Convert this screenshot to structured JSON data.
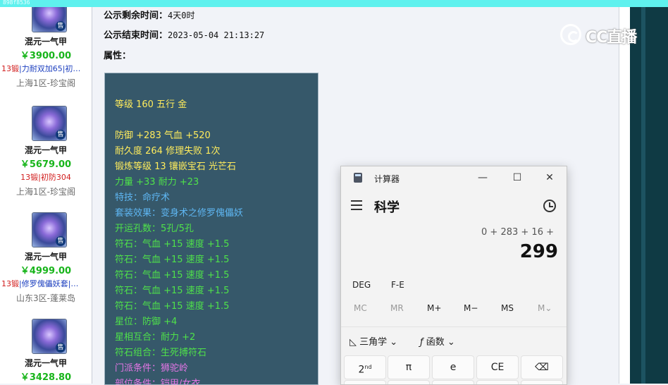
{
  "topbar": {
    "label": "898f8536"
  },
  "listings": [
    {
      "name": "混元一气甲",
      "price": "￥3900.00",
      "attr_red": "13锻",
      "attr_rest": "|力耐双加65|初…",
      "server": "上海1区-珍宝阁",
      "sell_badge": "售"
    },
    {
      "name": "混元一气甲",
      "price": "￥5679.00",
      "attr_red": "13锻|初防304",
      "attr_rest": "",
      "server": "上海1区-珍宝阁",
      "sell_badge": "售"
    },
    {
      "name": "混元一气甲",
      "price": "￥4999.00",
      "attr_red": "13锻",
      "attr_rest": "|修罗傀儡妖套|…",
      "server": "山东3区-蓬莱岛",
      "sell_badge": "售"
    },
    {
      "name": "混元一气甲",
      "price": "￥3428.80",
      "attr_red": "",
      "attr_rest": "",
      "server": "",
      "sell_badge": "售"
    }
  ],
  "detail": {
    "remaining_label": "公示剩余时间：",
    "remaining_value": "4天0时",
    "end_label": "公示结束时间：",
    "end_value": "2023-05-04 21:13:27",
    "attr_label": "属性："
  },
  "attributes": [
    {
      "text": "等级 160 五行 金",
      "color": "yellow"
    },
    {
      "text": "防御 +283 气血 +520",
      "color": "yellow"
    },
    {
      "text": "耐久度 264 修理失败 1次",
      "color": "yellow"
    },
    {
      "text": "锻炼等级 13 镶嵌宝石 光芒石",
      "color": "yellow"
    },
    {
      "text": "力量 +33 耐力 +23",
      "color": "green"
    },
    {
      "text": "特技：命疗术",
      "color": "blue"
    },
    {
      "text": "套装效果：变身术之修罗傀儡妖",
      "color": "blue"
    },
    {
      "text": "开运孔数：5孔/5孔",
      "color": "green"
    },
    {
      "text": "符石：气血 +15 速度 +1.5",
      "color": "green"
    },
    {
      "text": "符石：气血 +15 速度 +1.5",
      "color": "green"
    },
    {
      "text": "符石：气血 +15 速度 +1.5",
      "color": "green"
    },
    {
      "text": "符石：气血 +15 速度 +1.5",
      "color": "green"
    },
    {
      "text": "符石：气血 +15 速度 +1.5",
      "color": "green"
    },
    {
      "text": "星位：防御 +4",
      "color": "green"
    },
    {
      "text": "星相互合：耐力 +2",
      "color": "green"
    },
    {
      "text": "符石组合：生死搏符石",
      "color": "green"
    },
    {
      "text": "门派条件：狮驼岭",
      "color": "purple"
    },
    {
      "text": "部位条件：铠甲/女衣",
      "color": "purple"
    }
  ],
  "watermark": {
    "text": "CC直播"
  },
  "calculator": {
    "title": "计算器",
    "mode": "科学",
    "expression": "0 + 283 + 16 +",
    "result": "299",
    "angle": "DEG",
    "fe": "F-E",
    "memory": [
      "MC",
      "MR",
      "M+",
      "M−",
      "MS",
      "M⌄"
    ],
    "trig_label": "三角学",
    "func_label": "函数",
    "keys_row1": [
      "2nd",
      "π",
      "e",
      "CE",
      "⌫"
    ],
    "window_buttons": {
      "minimize": "—",
      "maximize": "☐",
      "close": "✕"
    }
  },
  "colors": {
    "yellow": "#ffec5c",
    "green": "#4fe24a",
    "blue": "#5eb6f2",
    "purple": "#e476e6"
  }
}
